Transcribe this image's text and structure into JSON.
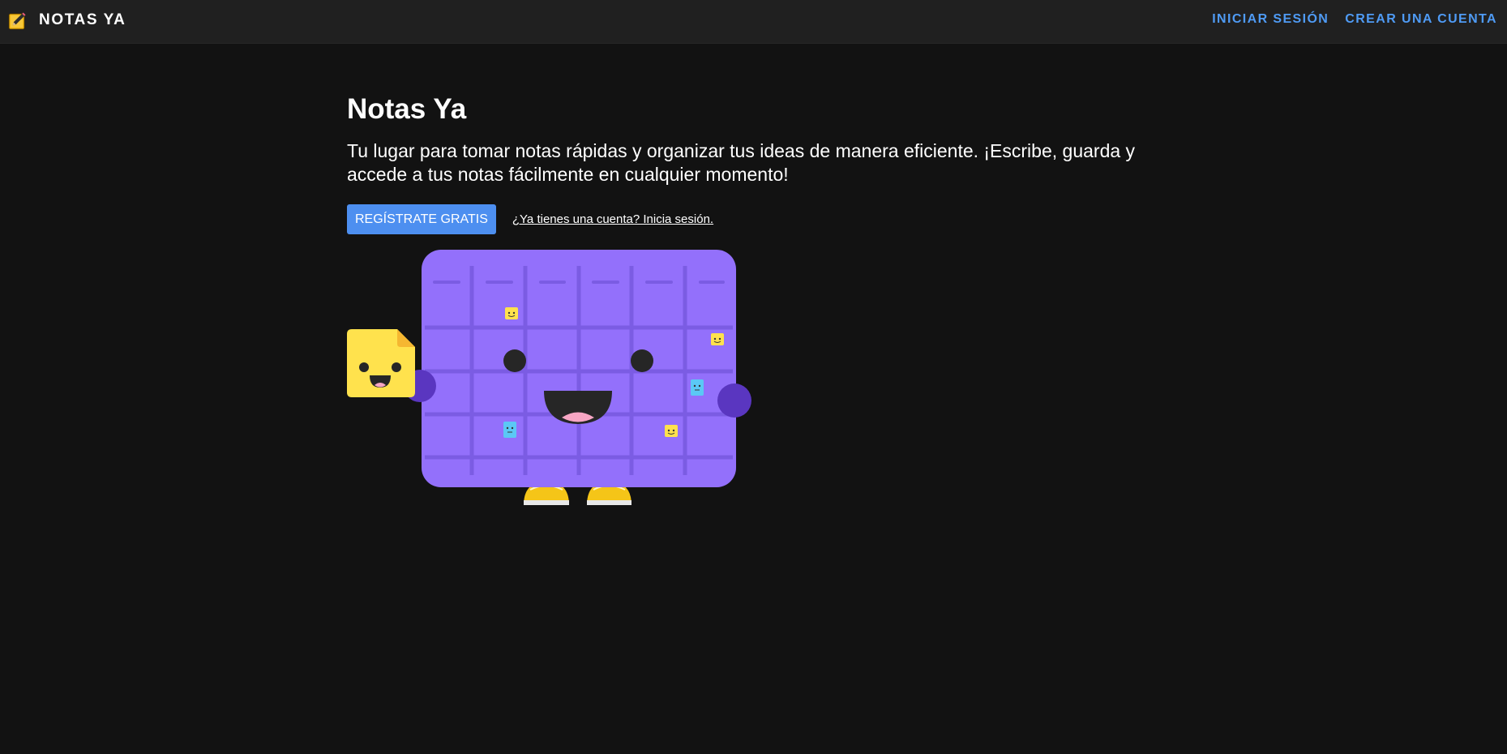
{
  "header": {
    "brand_icon": "pencil-note-icon",
    "brand_name": "NOTAS YA",
    "nav": {
      "login_label": "INICIAR SESIÓN",
      "signup_label": "CREAR UNA CUENTA"
    }
  },
  "hero": {
    "title": "Notas Ya",
    "description": "Tu lugar para tomar notas rápidas y organizar tus ideas de manera eficiente. ¡Escribe, guarda y accede a tus notas fácilmente en cualquier momento!",
    "primary_button_label": "REGÍSTRATE GRATIS",
    "login_link_label": "¿Ya tienes una cuenta? Inicia sesión."
  },
  "illustration": {
    "name": "smiling-calendar-illustration",
    "colors": {
      "calendar_body": "#9370fb",
      "grid_lines": "#7b5ce3",
      "hands": "#5a36c0",
      "sticky_note": "#ffe24d",
      "shoes": "#f5c518",
      "accent_blue": "#5bc8f5"
    }
  },
  "colors": {
    "background": "#121212",
    "header_background": "#202020",
    "accent": "#4f9bf5",
    "button": "#4d8ff0"
  }
}
